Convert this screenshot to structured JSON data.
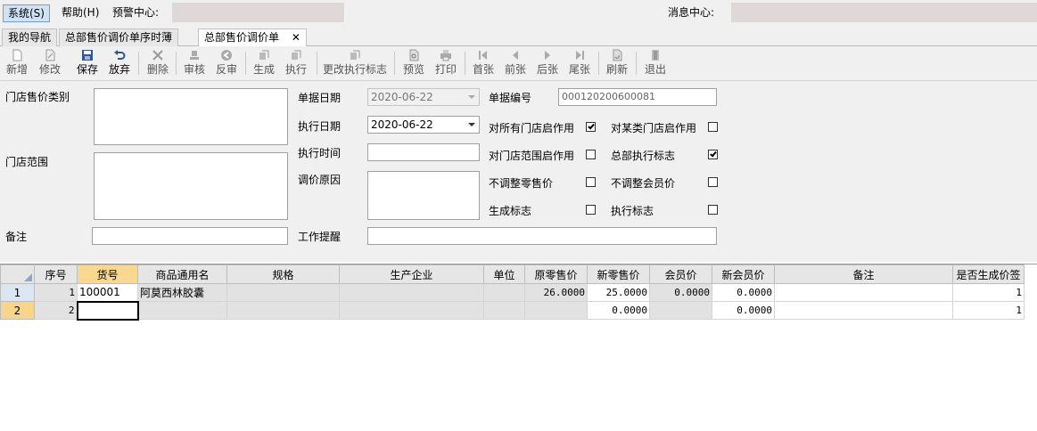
{
  "menu": {
    "system": "系统(S)",
    "help": "帮助(H)",
    "alert_label": "预警中心:",
    "message_label": "消息中心:"
  },
  "tabs": [
    {
      "label": "我的导航"
    },
    {
      "label": "总部售价调价单序时薄"
    },
    {
      "label": "总部售价调价单",
      "close": "✕"
    }
  ],
  "toolbar": {
    "new": "新增",
    "edit": "修改",
    "save": "保存",
    "discard": "放弃",
    "delete": "删除",
    "audit": "审核",
    "unaudit": "反审",
    "generate": "生成",
    "execute": "执行",
    "change_flag": "更改执行标志",
    "preview": "预览",
    "print": "打印",
    "first": "首张",
    "prev": "前张",
    "next": "后张",
    "last": "尾张",
    "refresh": "刷新",
    "exit": "退出"
  },
  "form": {
    "store_price_category_label": "门店售价类别",
    "store_range_label": "门店范围",
    "remark_label": "备注",
    "doc_date_label": "单据日期",
    "doc_date_value": "2020-06-22",
    "exec_date_label": "执行日期",
    "exec_date_value": "2020-06-22",
    "exec_time_label": "执行时间",
    "exec_time_value": "",
    "reason_label": "调价原因",
    "work_reminder_label": "工作提醒",
    "doc_no_label": "单据编号",
    "doc_no_value": "000120200600081",
    "cb_all_stores": "对所有门店启作用",
    "cb_category_stores": "对某类门店启作用",
    "cb_store_range": "对门店范围启作用",
    "cb_hq_exec_flag": "总部执行标志",
    "cb_no_retail": "不调整零售价",
    "cb_no_member": "不调整会员价",
    "cb_generate_flag": "生成标志",
    "cb_exec_flag": "执行标志",
    "checked": {
      "all_stores": true,
      "category_stores": false,
      "store_range": false,
      "hq_exec_flag": true,
      "no_retail": false,
      "no_member": false,
      "generate_flag": false,
      "exec_flag": false
    }
  },
  "grid": {
    "columns": [
      "序号",
      "货号",
      "商品通用名",
      "规格",
      "生产企业",
      "单位",
      "原零售价",
      "新零售价",
      "会员价",
      "新会员价",
      "备注",
      "是否生成价签"
    ],
    "rows": [
      {
        "rownum": "1",
        "seq": "1",
        "code": "100001",
        "name": "阿莫西林胶囊",
        "spec": "",
        "maker": "",
        "unit": "",
        "old_price": "26.0000",
        "new_price": "25.0000",
        "member_price": "0.0000",
        "new_member_price": "0.0000",
        "note": "",
        "tag": "1"
      },
      {
        "rownum": "2",
        "seq": "2",
        "code": "",
        "name": "",
        "spec": "",
        "maker": "",
        "unit": "",
        "old_price": "",
        "new_price": "0.0000",
        "member_price": "",
        "new_member_price": "0.0000",
        "note": "",
        "tag": "1"
      }
    ]
  }
}
